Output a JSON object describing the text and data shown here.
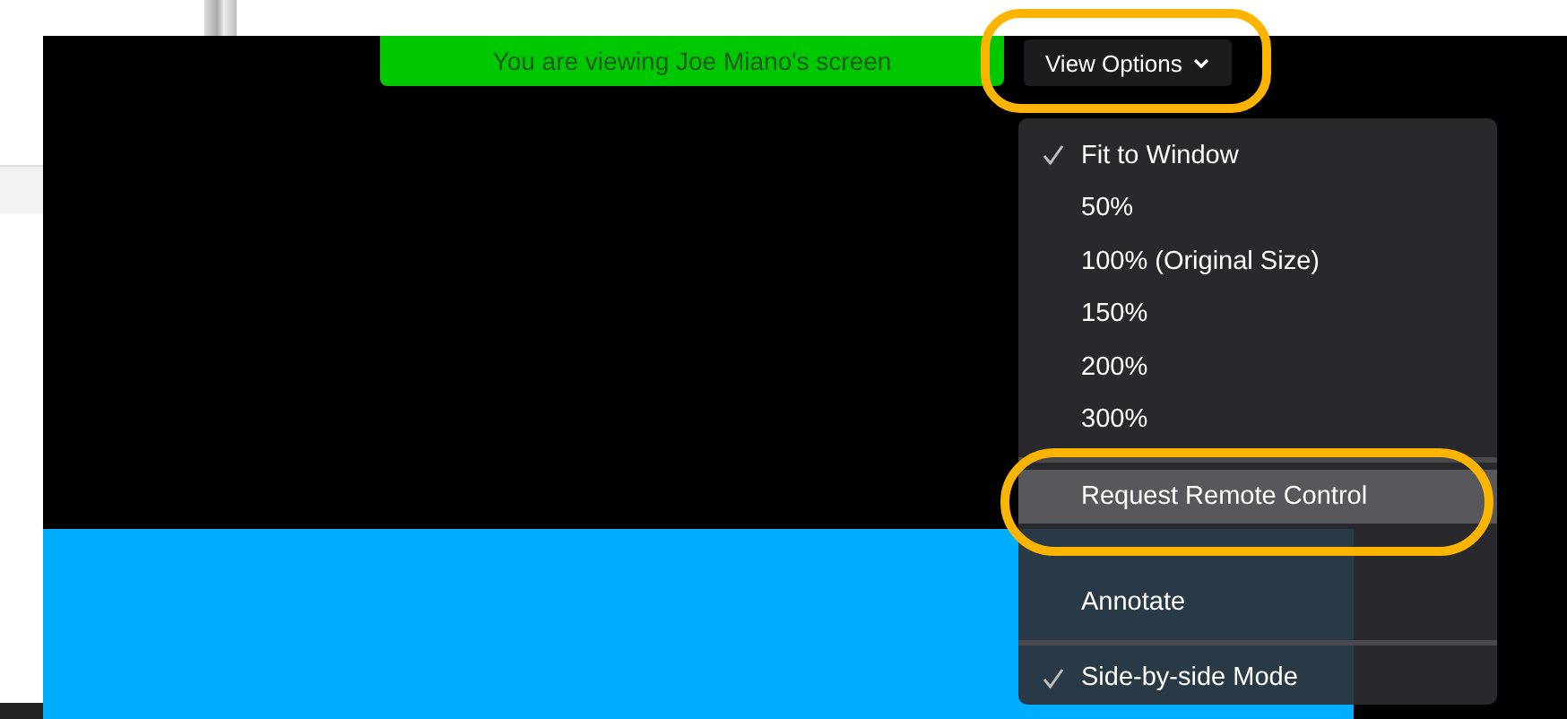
{
  "banner": {
    "text": "You are viewing Joe Miano's screen"
  },
  "view_options": {
    "label": "View Options",
    "circled": true
  },
  "menu": {
    "items": [
      {
        "kind": "item",
        "label": "Fit to Window",
        "checked": true,
        "selected": false,
        "circled": false
      },
      {
        "kind": "item",
        "label": "50%",
        "checked": false,
        "selected": false,
        "circled": false
      },
      {
        "kind": "item",
        "label": "100% (Original Size)",
        "checked": false,
        "selected": false,
        "circled": false
      },
      {
        "kind": "item",
        "label": "150%",
        "checked": false,
        "selected": false,
        "circled": false
      },
      {
        "kind": "item",
        "label": "200%",
        "checked": false,
        "selected": false,
        "circled": false
      },
      {
        "kind": "item",
        "label": "300%",
        "checked": false,
        "selected": false,
        "circled": false
      },
      {
        "kind": "separator"
      },
      {
        "kind": "item",
        "label": "Request Remote Control",
        "checked": false,
        "selected": true,
        "circled": true
      },
      {
        "kind": "obscured"
      },
      {
        "kind": "item",
        "label": "Annotate",
        "checked": false,
        "selected": false,
        "circled": false
      },
      {
        "kind": "separator"
      },
      {
        "kind": "item",
        "label": "Side-by-side Mode",
        "checked": true,
        "selected": false,
        "circled": false
      }
    ]
  }
}
